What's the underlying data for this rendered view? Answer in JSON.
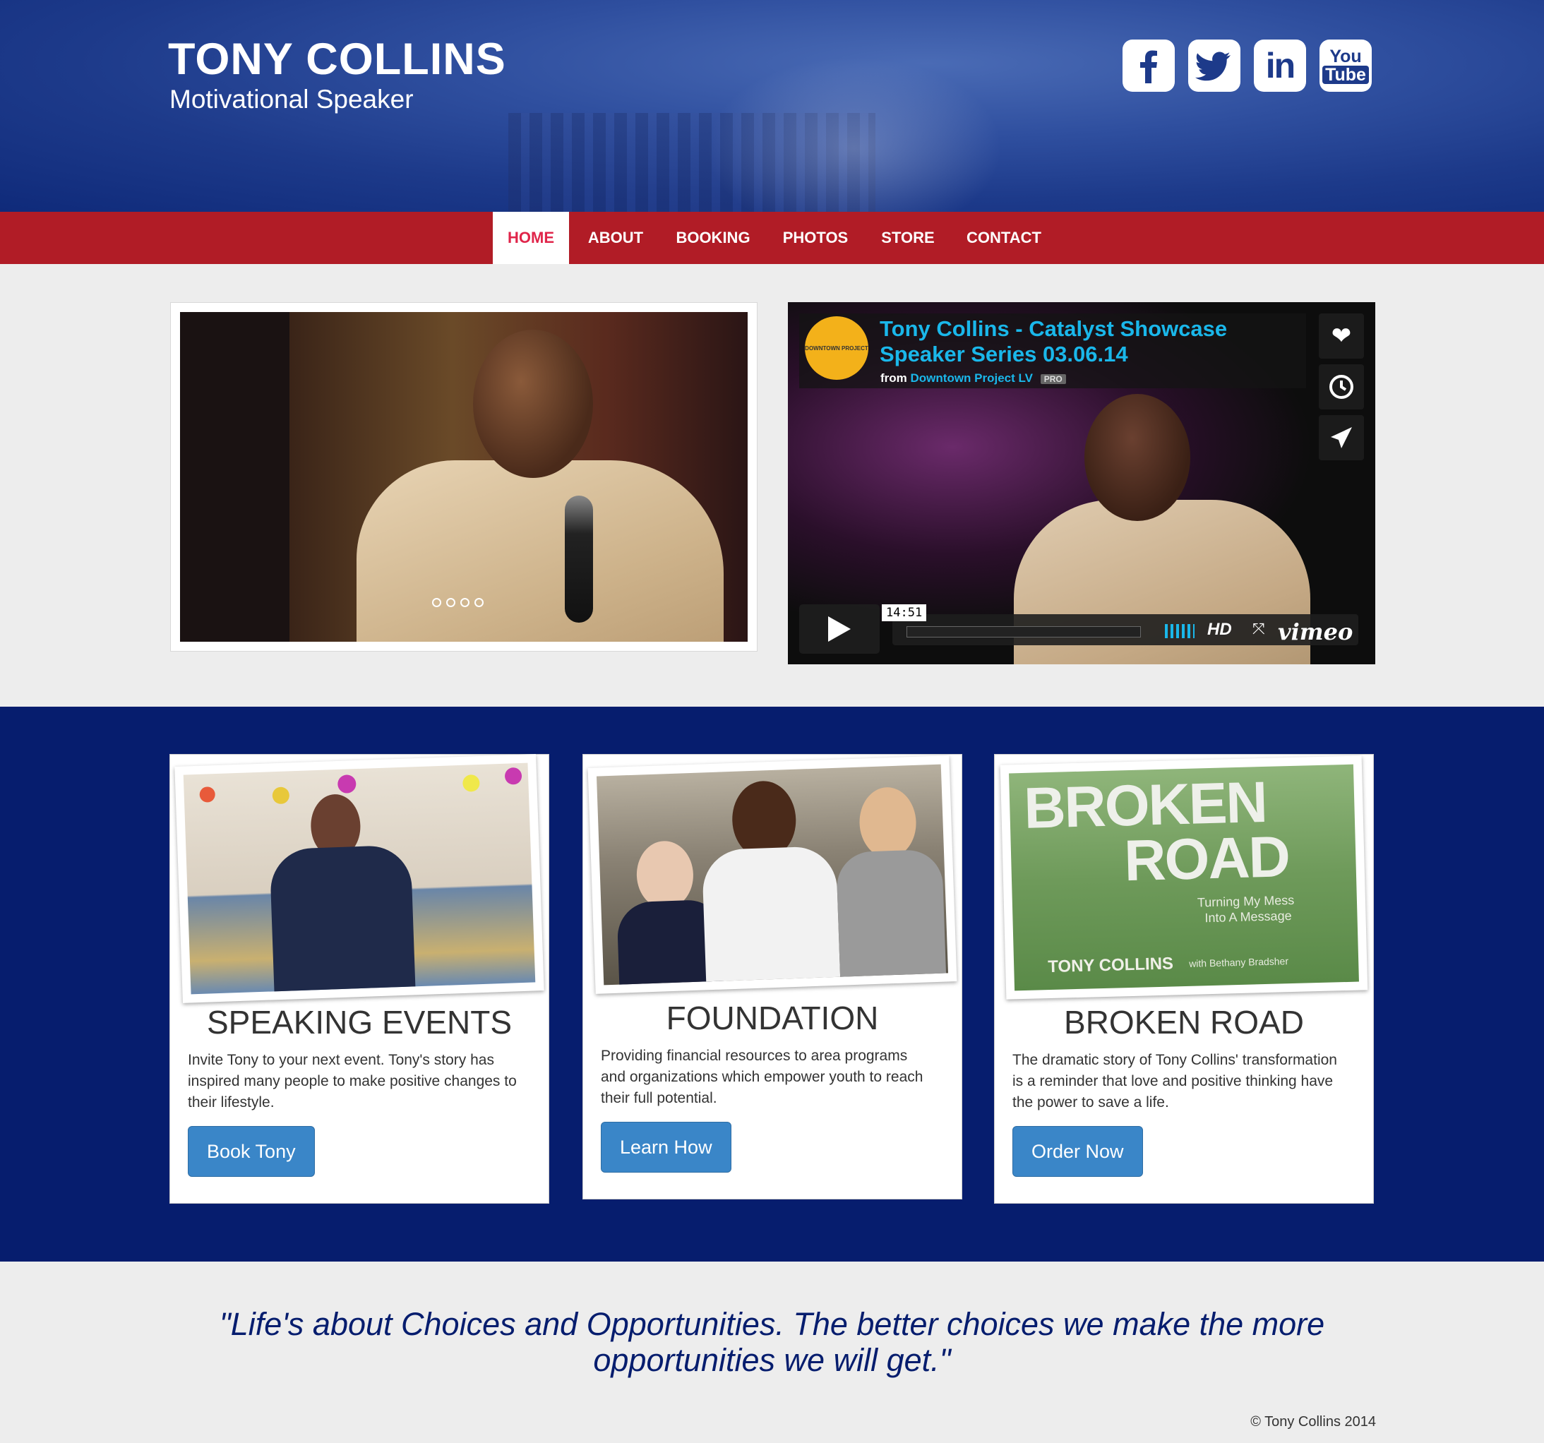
{
  "header": {
    "title": "TONY COLLINS",
    "subtitle": "Motivational Speaker",
    "social": [
      {
        "name": "facebook",
        "glyph": "f"
      },
      {
        "name": "twitter",
        "glyph": "t"
      },
      {
        "name": "linkedin",
        "glyph": "in"
      },
      {
        "name": "youtube",
        "glyph_line1": "You",
        "glyph_line2": "Tube"
      }
    ]
  },
  "nav": {
    "items": [
      {
        "label": "HOME",
        "active": true
      },
      {
        "label": "ABOUT"
      },
      {
        "label": "BOOKING"
      },
      {
        "label": "PHOTOS"
      },
      {
        "label": "STORE"
      },
      {
        "label": "CONTACT"
      }
    ]
  },
  "hero": {
    "slider_dots": 4,
    "video": {
      "channel_logo": "DOWNTOWN PROJECT",
      "title": "Tony Collins - Catalyst Showcase Speaker Series 03.06.14",
      "from_label": "from",
      "from_channel": "Downtown Project LV",
      "badge": "PRO",
      "duration": "14:51",
      "hd_label": "HD",
      "brand": "vimeo"
    }
  },
  "cards": [
    {
      "title": "SPEAKING EVENTS",
      "text": "Invite Tony to your next event. Tony's story has inspired many people to make positive changes to their lifestyle.",
      "button": "Book Tony"
    },
    {
      "title": "FOUNDATION",
      "text": "Providing financial resources to area programs and organizations which empower youth to reach their full potential.",
      "button": "Learn How"
    },
    {
      "title": "BROKEN ROAD",
      "text": "The dramatic story of Tony Collins' transformation is a reminder that love and positive thinking have the power to save a life.",
      "button": "Order Now",
      "book_cover": {
        "line1": "BROKEN",
        "line2": "ROAD",
        "tagline1": "Turning My Mess",
        "tagline2": "Into A Message",
        "author": "TONY COLLINS",
        "coauthor": "with Bethany Bradsher"
      }
    }
  ],
  "quote": "\"Life's about Choices and Opportunities. The better choices we make the more opportunities we will get.\"",
  "copyright": "© Tony Collins 2014",
  "colors": {
    "header_blue": "#1d3a8a",
    "nav_red": "#b11c26",
    "band_navy": "#061d6e",
    "button_blue": "#3a86c8",
    "vimeo_blue": "#1ab7ea",
    "active_nav_text": "#e0254a"
  }
}
